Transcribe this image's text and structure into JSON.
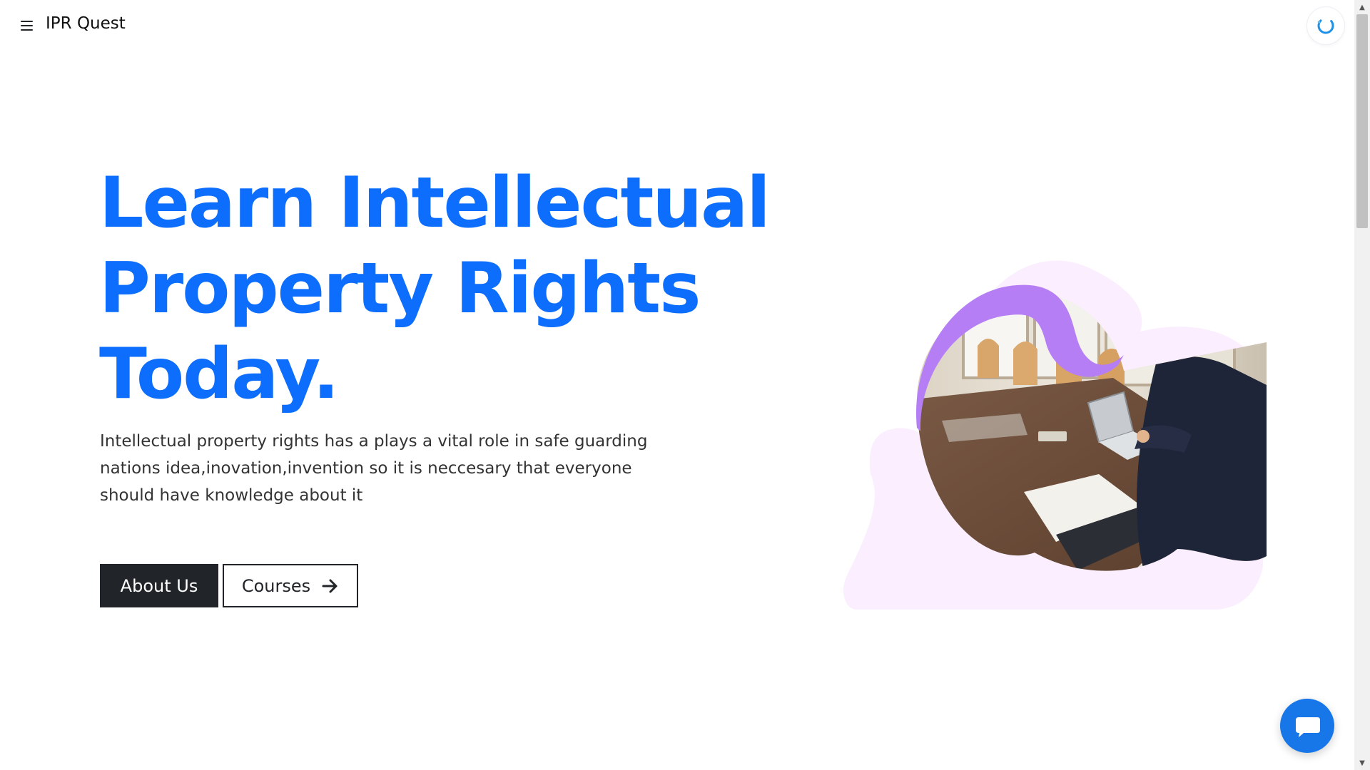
{
  "navbar": {
    "menu_icon": "hamburger-menu-icon",
    "brand": "IPR Quest",
    "loader_icon": "loading-spinner-icon"
  },
  "hero": {
    "title_line_1": "Learn Intellectual",
    "title_line_2": "Property Rights",
    "title_line_3": "Today.",
    "description": "Intellectual property rights has a plays a vital role in safe guarding nations idea,inovation,invention so it is neccesary that everyone should have knowledge about it",
    "about_button": "About Us",
    "courses_button": "Courses",
    "courses_icon": "arrow-right-icon",
    "image": "person-at-conference-table-photo"
  },
  "chat": {
    "icon": "chat-bubble-icon"
  },
  "colors": {
    "primary": "#0d6efd",
    "dark": "#212529",
    "blob_pink": "#fbeefe",
    "ribbon_purple": "#b67ef5",
    "chat_blue": "#1877e8"
  }
}
